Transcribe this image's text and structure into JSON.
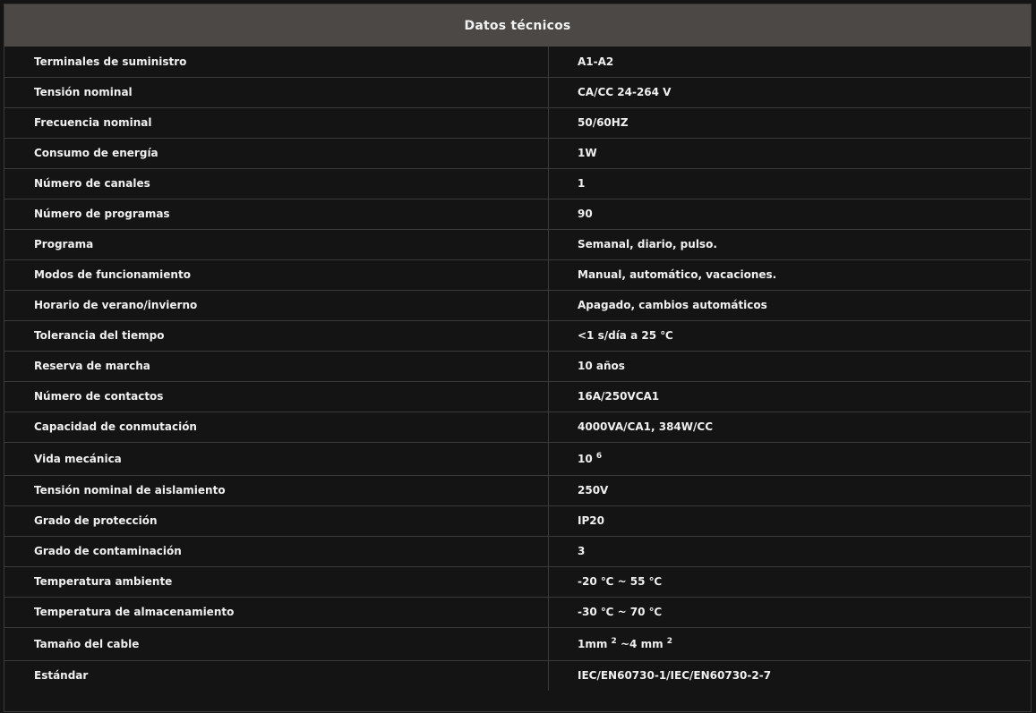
{
  "table": {
    "title": "Datos técnicos",
    "rows": [
      {
        "label": "Terminales de suministro",
        "value": "A1-A2"
      },
      {
        "label": "Tensión nominal",
        "value": "CA/CC 24-264 V"
      },
      {
        "label": "Frecuencia nominal",
        "value": "50/60HZ"
      },
      {
        "label": "Consumo de energía",
        "value": "1W"
      },
      {
        "label": "Número de canales",
        "value": "1"
      },
      {
        "label": "Número de programas",
        "value": "90"
      },
      {
        "label": "Programa",
        "value": "Semanal, diario, pulso."
      },
      {
        "label": "Modos de funcionamiento",
        "value": "Manual, automático, vacaciones."
      },
      {
        "label": "Horario de verano/invierno",
        "value": "Apagado, cambios automáticos"
      },
      {
        "label": "Tolerancia del tiempo",
        "value": "<1 s/día a 25 ℃"
      },
      {
        "label": "Reserva de marcha",
        "value": "10 años"
      },
      {
        "label": "Número de contactos",
        "value": "16A/250VCA1"
      },
      {
        "label": "Capacidad de conmutación",
        "value": "4000VA/CA1, 384W/CC"
      },
      {
        "label": "Vida mecánica",
        "value_base": "10 ",
        "value_exp": "6"
      },
      {
        "label": "Tensión nominal de aislamiento",
        "value": "250V"
      },
      {
        "label": "Grado de protección",
        "value": "IP20"
      },
      {
        "label": "Grado de contaminación",
        "value": "3"
      },
      {
        "label": "Temperatura ambiente",
        "value": "-20 ℃ ~ 55 ℃"
      },
      {
        "label": "Temperatura de almacenamiento",
        "value": "-30 ℃ ~ 70 ℃"
      },
      {
        "label": "Tamaño del cable",
        "value_a": "1mm ",
        "value_a_exp": "2",
        "value_b": " ~4 mm ",
        "value_b_exp": "2"
      },
      {
        "label": "Estándar",
        "value": "IEC/EN60730-1/IEC/EN60730-2-7"
      }
    ]
  }
}
